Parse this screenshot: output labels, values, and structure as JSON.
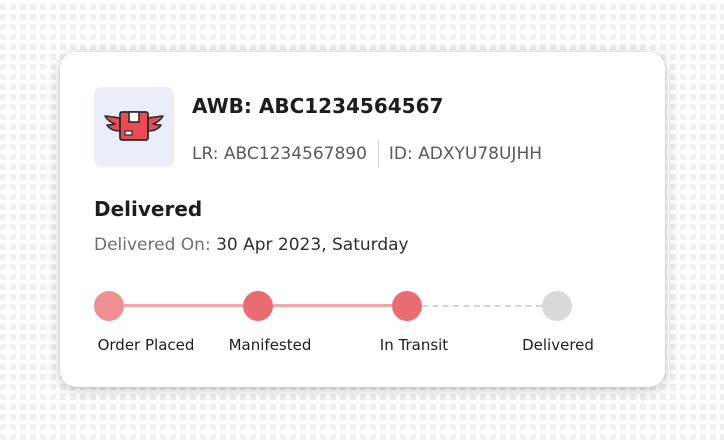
{
  "shipment": {
    "awb_line": "AWB: ABC1234564567",
    "lr_line": "LR: ABC1234567890",
    "id_line": "ID: ADXYU78UJHH",
    "icon": "winged-box-icon"
  },
  "status": {
    "title": "Delivered",
    "delivered_on_label": "Delivered On:",
    "delivered_on_value": "30 Apr 2023, Saturday"
  },
  "tracker": {
    "steps": [
      {
        "label": "Order Placed",
        "state": "done"
      },
      {
        "label": "Manifested",
        "state": "done"
      },
      {
        "label": "In Transit",
        "state": "done"
      },
      {
        "label": "Delivered",
        "state": "pending"
      }
    ]
  },
  "colors": {
    "accent": "#ea6c73",
    "accent_light": "#f2a6a6",
    "first_dot": "#ef8f94",
    "pending": "#d9d9d9",
    "icon_tile_bg": "#e9eefa"
  }
}
